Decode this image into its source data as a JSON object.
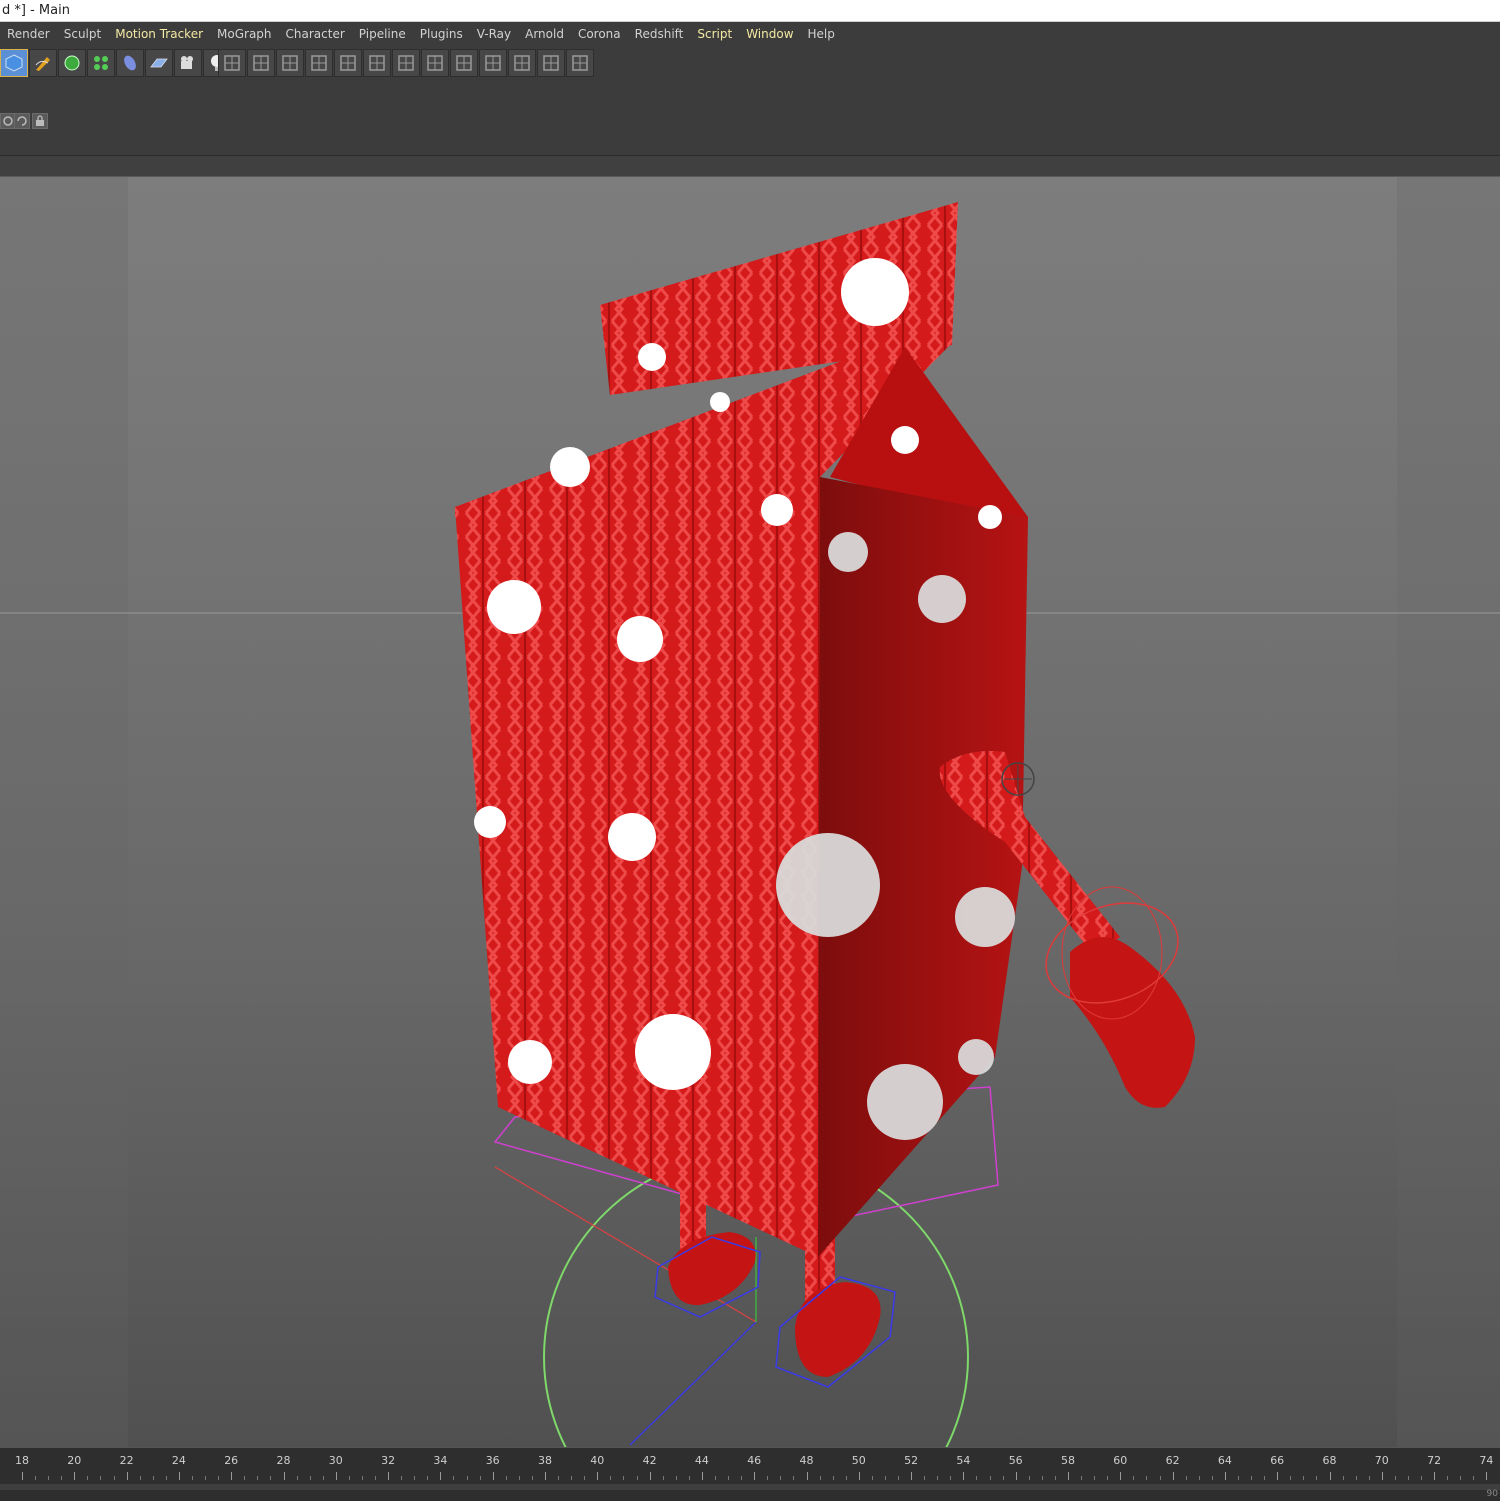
{
  "window": {
    "title": "d *] - Main"
  },
  "menu": {
    "items": [
      {
        "label": "Render",
        "highlight": false
      },
      {
        "label": "Sculpt",
        "highlight": false
      },
      {
        "label": "Motion Tracker",
        "highlight": true
      },
      {
        "label": "MoGraph",
        "highlight": false
      },
      {
        "label": "Character",
        "highlight": false
      },
      {
        "label": "Pipeline",
        "highlight": false
      },
      {
        "label": "Plugins",
        "highlight": false
      },
      {
        "label": "V-Ray",
        "highlight": false
      },
      {
        "label": "Arnold",
        "highlight": false
      },
      {
        "label": "Corona",
        "highlight": false
      },
      {
        "label": "Redshift",
        "highlight": false
      },
      {
        "label": "Script",
        "highlight": true
      },
      {
        "label": "Window",
        "highlight": true
      },
      {
        "label": "Help",
        "highlight": false
      }
    ]
  },
  "toolbar": {
    "icons": [
      "cube-icon",
      "pen-icon",
      "subdivision-icon",
      "cloner-icon",
      "deformer-icon",
      "floor-icon",
      "camera-icon",
      "light-icon"
    ],
    "gray_icons": [
      "joint-icon",
      "ik-icon",
      "skin-icon",
      "weight-icon",
      "bone-icon",
      "morph-icon",
      "pose-icon",
      "cmotion-icon",
      "mirror-icon",
      "grid-a-icon",
      "grid-b-icon",
      "grid-c-icon",
      "grid-d-icon"
    ]
  },
  "colors": {
    "accent": "#f3e9a3",
    "carton_red": "#d01818",
    "viewport_bg": "#767676"
  },
  "timeline": {
    "ticks": [
      "18",
      "20",
      "22",
      "24",
      "26",
      "28",
      "30",
      "32",
      "34",
      "36",
      "38",
      "40",
      "42",
      "44",
      "46",
      "48",
      "50",
      "52",
      "54",
      "56",
      "58",
      "60",
      "62",
      "64",
      "66",
      "68",
      "70",
      "72",
      "74"
    ],
    "end_label": "90"
  }
}
